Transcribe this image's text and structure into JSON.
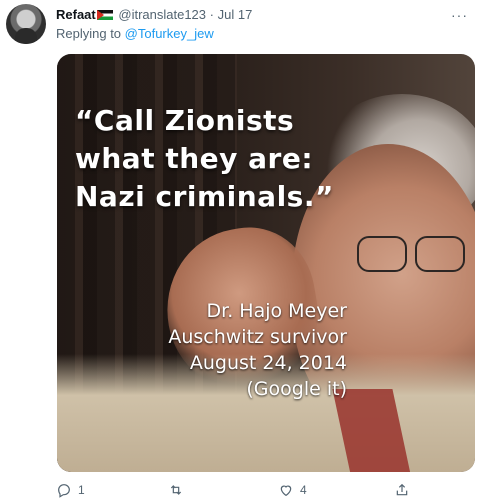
{
  "tweet": {
    "display_name": "Refaat",
    "handle": "@itranslate123",
    "separator": "·",
    "date": "Jul 17",
    "more_label": "···",
    "replying_prefix": "Replying to ",
    "replying_to": "@Tofurkey_jew"
  },
  "media": {
    "quote_lines": [
      "“Call Zionists",
      "what they are:",
      "Nazi criminals.”"
    ],
    "caption_lines": [
      "Dr. Hajo Meyer",
      "Auschwitz survivor",
      "August 24, 2014",
      "(Google it)"
    ]
  },
  "actions": {
    "reply_count": "1",
    "retweet_count": "",
    "like_count": "4",
    "icons": [
      "reply-icon",
      "retweet-icon",
      "like-icon",
      "share-icon"
    ]
  }
}
